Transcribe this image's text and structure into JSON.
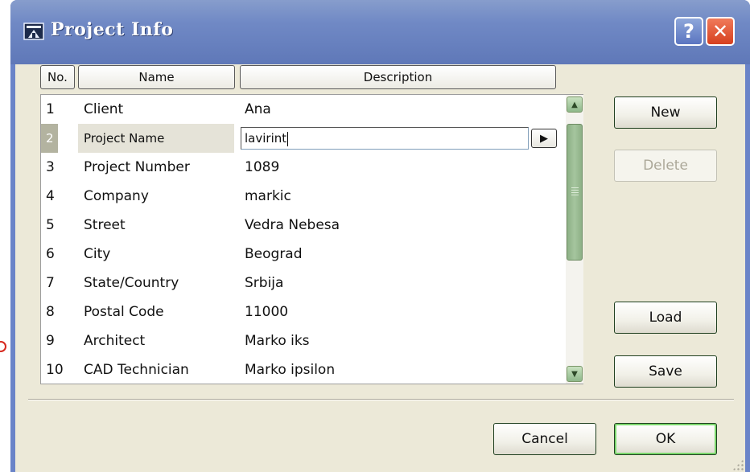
{
  "window": {
    "title": "Project Info",
    "help_symbol": "?",
    "close_symbol": "✕",
    "icon": "project-info-icon"
  },
  "table": {
    "headers": {
      "no": "No.",
      "name": "Name",
      "description": "Description"
    },
    "rows": [
      {
        "no": "1",
        "name": "Client",
        "description": "Ana"
      },
      {
        "no": "2",
        "name": "Project Name",
        "description": "lavirint"
      },
      {
        "no": "3",
        "name": "Project Number",
        "description": "1089"
      },
      {
        "no": "4",
        "name": "Company",
        "description": "markic"
      },
      {
        "no": "5",
        "name": "Street",
        "description": "Vedra Nebesa"
      },
      {
        "no": "6",
        "name": "City",
        "description": "Beograd"
      },
      {
        "no": "7",
        "name": "State/Country",
        "description": "Srbija"
      },
      {
        "no": "8",
        "name": "Postal Code",
        "description": "11000"
      },
      {
        "no": "9",
        "name": "Architect",
        "description": "Marko iks"
      },
      {
        "no": "10",
        "name": "CAD Technician",
        "description": "Marko ipsilon"
      }
    ],
    "selected_row_index": 1,
    "edit_arrow_symbol": "▶"
  },
  "scrollbar": {
    "up_symbol": "▲",
    "down_symbol": "▼"
  },
  "buttons": {
    "new": "New",
    "delete": "Delete",
    "load": "Load",
    "save": "Save",
    "cancel": "Cancel",
    "ok": "OK"
  }
}
